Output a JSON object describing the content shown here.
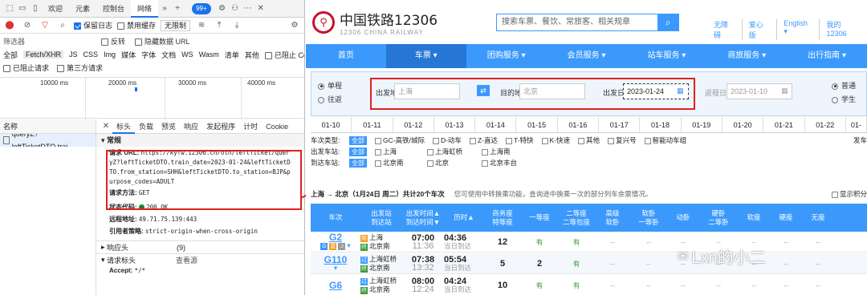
{
  "devtools": {
    "tabs": [
      "欢迎",
      "元素",
      "控制台",
      "网络"
    ],
    "issues_badge": "99+",
    "toolbar": {
      "preserve_log": "保留日志",
      "disable_cache": "禁用缓存",
      "throttle": "无限制"
    },
    "filter": {
      "placeholder": "筛选器",
      "invert": "反转",
      "hide_data_urls": "隐藏数据 URL"
    },
    "types": [
      "全部",
      "Fetch/XHR",
      "JS",
      "CSS",
      "Img",
      "媒体",
      "字体",
      "文档",
      "WS",
      "Wasm",
      "清单",
      "其他"
    ],
    "blocked_cookies": "已阻止 Cookie",
    "blocked_requests": "已阻止请求",
    "third_party": "第三方请求",
    "timeline": [
      "10000 ms",
      "20000 ms",
      "30000 ms",
      "40000 ms"
    ],
    "name_header": "名称",
    "request_name": "queryZ?leftTicketDTO.trai...",
    "detail_tabs": [
      "标头",
      "负载",
      "预览",
      "响应",
      "发起程序",
      "计时",
      "Cookie"
    ],
    "general_title": "常规",
    "request_url_label": "请求 URL:",
    "request_url": "https://kyfw.12306.cn/otn/leftTicket/queryZ?leftTicketDTO.train_date=2023-01-24&leftTicketDTO.from_station=SHH&leftTicketDTO.to_station=BJP&purpose_codes=ADULT",
    "method_label": "请求方法:",
    "method": "GET",
    "status_label": "状态代码:",
    "status": "200 OK",
    "remote_label": "远程地址:",
    "remote": "49.71.75.139:443",
    "referrer_label": "引用者策略:",
    "referrer": "strict-origin-when-cross-origin",
    "response_headers": "响应头",
    "response_count": "(9)",
    "request_headers": "请求标头",
    "view_source": "查看源",
    "accept_label": "Accept:",
    "accept": "*/*"
  },
  "site": {
    "logo_title": "中国铁路12306",
    "logo_sub": "12306 CHINA RAILWAY",
    "search_placeholder": "搜索车票、餐饮、常旅客、相关规章",
    "top_links": [
      "无障碍",
      "爱心版",
      "English ▾",
      "我的12306"
    ],
    "nav": [
      "首页",
      "车票 ▾",
      "团购服务 ▾",
      "会员服务 ▾",
      "站车服务 ▾",
      "商旅服务 ▾",
      "出行指南 ▾"
    ],
    "one_way": "单程",
    "round_trip": "往返",
    "from_label": "出发地",
    "from_value": "上海",
    "to_label": "目的地",
    "to_value": "北京",
    "date_label": "出发日",
    "date_value": "2023-01-24",
    "return_label": "返程日",
    "return_value": "2023-01-10",
    "normal": "普通",
    "student": "学生",
    "dates": [
      "01-10",
      "01-11",
      "01-12",
      "01-13",
      "01-14",
      "01-15",
      "01-16",
      "01-17",
      "01-18",
      "01-19",
      "01-20",
      "01-21",
      "01-22",
      "01-"
    ],
    "filters": {
      "type_label": "车次类型:",
      "types": [
        "GC-高铁/城际",
        "D-动车",
        "Z-直达",
        "T-特快",
        "K-快速",
        "其他",
        "复兴号",
        "智能动车组"
      ],
      "from_label": "出发车站:",
      "from_stations": [
        "上海",
        "上海虹桥",
        "上海南"
      ],
      "to_label": "到达车站:",
      "to_stations": [
        "北京南",
        "北京",
        "北京丰台"
      ],
      "all": "全部",
      "depart_label": "发车"
    },
    "summary": "上海 → 北京（1月24日 周二）共计20个车次",
    "transfer_note": "您可使用中转换乘功能，查询途中换乘一次的部分列车余票情况。",
    "show_points": "显示积分",
    "columns": [
      "车次",
      "出发站\n到达站",
      "出发时间▲\n到达时间▼",
      "历时▲",
      "商务座\n特等座",
      "一等座",
      "二等座\n二等包座",
      "高级\n软卧",
      "软卧\n一等卧",
      "动卧",
      "硬卧\n二等卧",
      "软座",
      "硬座",
      "无座"
    ],
    "trains": [
      {
        "no": "G2",
        "from": "上海",
        "to": "北京南",
        "dep": "07:00",
        "arr": "11:36",
        "dur": "04:36",
        "day": "当日到达",
        "biz": "12",
        "first": "有",
        "second": "有"
      },
      {
        "no": "G110",
        "from": "上海虹桥",
        "to": "北京南",
        "dep": "07:38",
        "arr": "13:32",
        "dur": "05:54",
        "day": "当日到达",
        "biz": "5",
        "first": "2",
        "second": "有"
      },
      {
        "no": "G6",
        "from": "上海虹桥",
        "to": "北京南",
        "dep": "08:00",
        "arr": "12:24",
        "dur": "04:24",
        "day": "当日到达",
        "biz": "10",
        "first": "有",
        "second": "有"
      }
    ],
    "dash": "--",
    "watermark": "Lxn的小二"
  }
}
